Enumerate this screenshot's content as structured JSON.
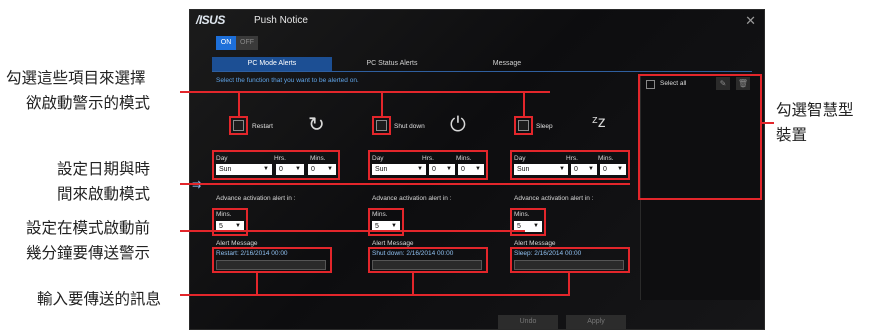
{
  "annotations": {
    "a1": "勾選這些項目來選擇",
    "a1b": "欲啟動警示的模式",
    "a2": "設定日期與時",
    "a2b": "間來啟動模式",
    "a3": "設定在模式啟動前",
    "a3b": "幾分鐘要傳送警示",
    "a4": "輸入要傳送的訊息",
    "a5": "勾選智慧型",
    "a5b": "裝置"
  },
  "window": {
    "logo": "/ISUS",
    "title": "Push Notice",
    "close": "✕",
    "toggle_on": "ON",
    "toggle_off": "OFF"
  },
  "tabs": [
    "PC Mode Alerts",
    "PC Status Alerts",
    "Message"
  ],
  "hint": "Select the function that you want to be alerted on.",
  "modes": [
    {
      "label": "Restart",
      "icon": "↻",
      "day": "Sun",
      "hrs": "0",
      "mins": "0",
      "adv_mins": "5",
      "message": "Restart: 2/16/2014 00:00"
    },
    {
      "label": "Shut down",
      "icon": "⏻",
      "day": "Sun",
      "hrs": "0",
      "mins": "0",
      "adv_mins": "5",
      "message": "Shut down: 2/16/2014 00:00"
    },
    {
      "label": "Sleep",
      "icon": "ᶻz",
      "day": "Sun",
      "hrs": "0",
      "mins": "0",
      "adv_mins": "5",
      "message": "Sleep: 2/16/2014 00:00"
    }
  ],
  "labels": {
    "day": "Day",
    "hrs": "Hrs.",
    "mins": "Mins.",
    "advance": "Advance activation alert in :",
    "alert_message": "Alert Message"
  },
  "sidepanel": {
    "select_all": "Select all"
  },
  "buttons": {
    "undo": "Undo",
    "apply": "Apply"
  },
  "colors": {
    "accent": "#1d6fd9",
    "highlight": "#e3262b"
  }
}
